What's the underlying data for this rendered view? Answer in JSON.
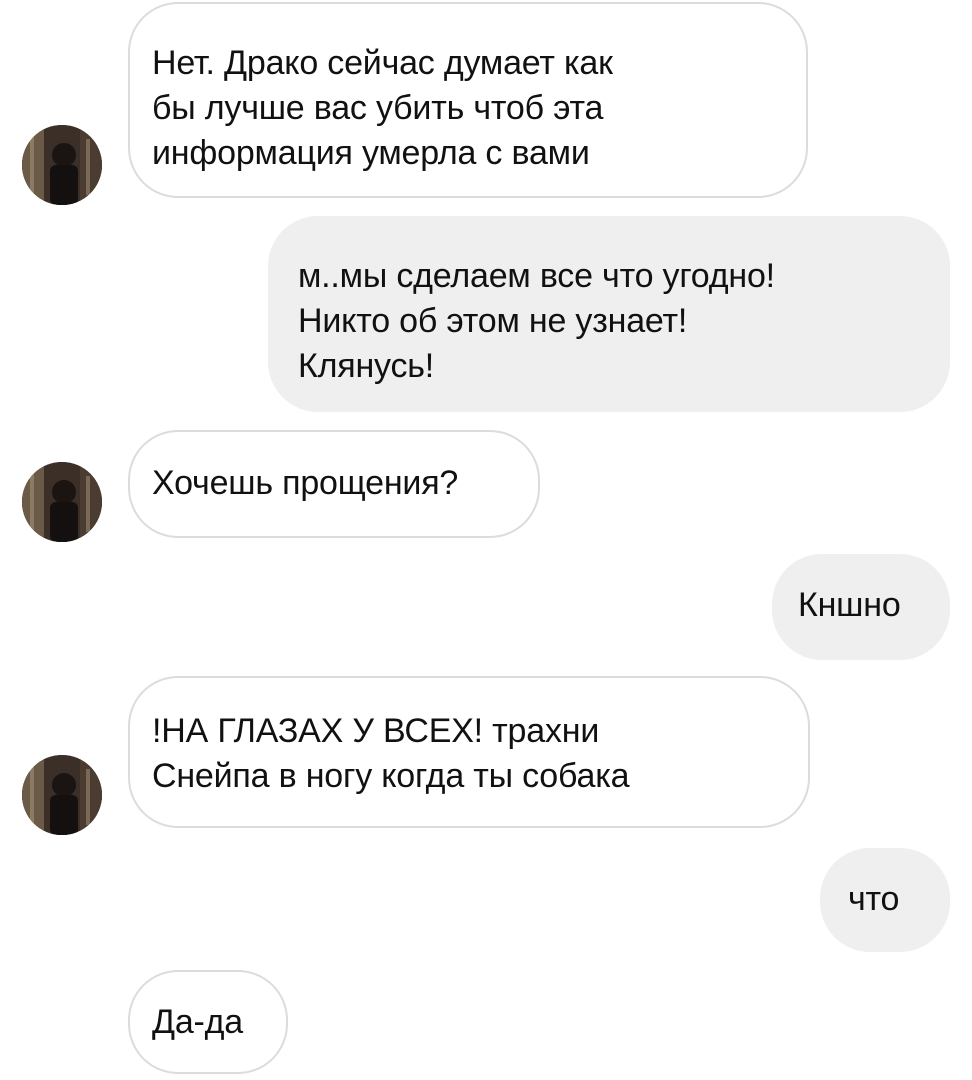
{
  "messages": [
    {
      "sender": "them",
      "lines": [
        "Нет. Драко сейчас думает как",
        "бы лучше вас убить чтоб эта",
        "информация умерла с вами"
      ]
    },
    {
      "sender": "me",
      "lines": [
        "м..мы сделаем все что угодно!",
        "Никто об этом не узнает!",
        "Клянусь!"
      ]
    },
    {
      "sender": "them",
      "lines": [
        "Хочешь прощения?"
      ]
    },
    {
      "sender": "me",
      "lines": [
        "Кншно"
      ]
    },
    {
      "sender": "them",
      "lines": [
        "!НА ГЛАЗАХ У ВСЕХ! трахни",
        "Снейпа в ногу когда ты собака"
      ]
    },
    {
      "sender": "me",
      "lines": [
        "что"
      ]
    },
    {
      "sender": "them",
      "lines": [
        "Да-да"
      ]
    }
  ],
  "colors": {
    "incoming_bubble_bg": "#ffffff",
    "incoming_bubble_border": "#dcdcdc",
    "outgoing_bubble_bg": "#efefef",
    "text": "#111111"
  },
  "icons": {
    "avatar": "profile-photo-avatar"
  }
}
